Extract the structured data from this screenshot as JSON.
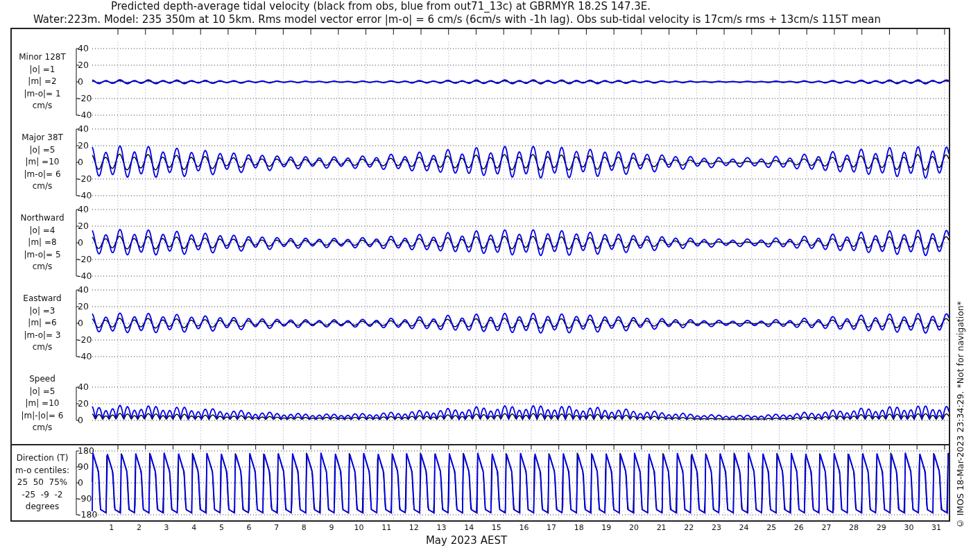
{
  "title": [
    "Predicted depth-average tidal velocity (black from obs, blue from out71_13c) at GBRMYR 18.2S 147.3E.",
    "Water:223m. Model: 235 350m at 10 5km. Rms model vector error |m-o| = 6 cm/s (6cm/s with -1h lag). Obs sub-tidal velocity is 17cm/s rms + 13cm/s 115T mean"
  ],
  "panels": [
    {
      "kind": "velocity",
      "label": [
        "Minor 128T",
        "|o| =1",
        "|m| =2",
        "|m-o|= 1",
        "cm/s"
      ],
      "yticks": [
        "40",
        "20",
        "0",
        "-20",
        "-40"
      ]
    },
    {
      "kind": "velocity",
      "label": [
        "Major 38T",
        "|o| =5",
        "|m| =10",
        "|m-o|= 6",
        "cm/s"
      ],
      "yticks": [
        "40",
        "20",
        "0",
        "-20",
        "-40"
      ]
    },
    {
      "kind": "velocity",
      "label": [
        "Northward",
        "|o| =4",
        "|m| =8",
        "|m-o|= 5",
        "cm/s"
      ],
      "yticks": [
        "40",
        "20",
        "0",
        "-20",
        "-40"
      ]
    },
    {
      "kind": "velocity",
      "label": [
        "Eastward",
        "|o| =3",
        "|m| =6",
        "|m-o|= 3",
        "cm/s"
      ],
      "yticks": [
        "40",
        "20",
        "0",
        "-20",
        "-40"
      ]
    },
    {
      "kind": "speed",
      "label": [
        "Speed",
        "|o| =5",
        "|m| =10",
        "|m|-|o|= 6",
        "cm/s"
      ],
      "yticks": [
        "40",
        "20",
        "0"
      ]
    },
    {
      "kind": "direction",
      "label": [
        "Direction (T)",
        "m-o centiles:",
        "25  50  75%",
        "-25  -9  -2",
        "degrees"
      ],
      "yticks": [
        "180",
        "90",
        "0",
        "-90",
        "-180"
      ]
    }
  ],
  "days": [
    "1",
    "2",
    "3",
    "4",
    "5",
    "6",
    "7",
    "8",
    "9",
    "10",
    "11",
    "12",
    "13",
    "14",
    "15",
    "16",
    "17",
    "18",
    "19",
    "20",
    "21",
    "22",
    "23",
    "24",
    "25",
    "26",
    "27",
    "28",
    "29",
    "30",
    "31"
  ],
  "xlabel": "May 2023 AEST",
  "credit": "© IMOS 18-Mar-2023 23:34:29. *Not for navigation*"
}
